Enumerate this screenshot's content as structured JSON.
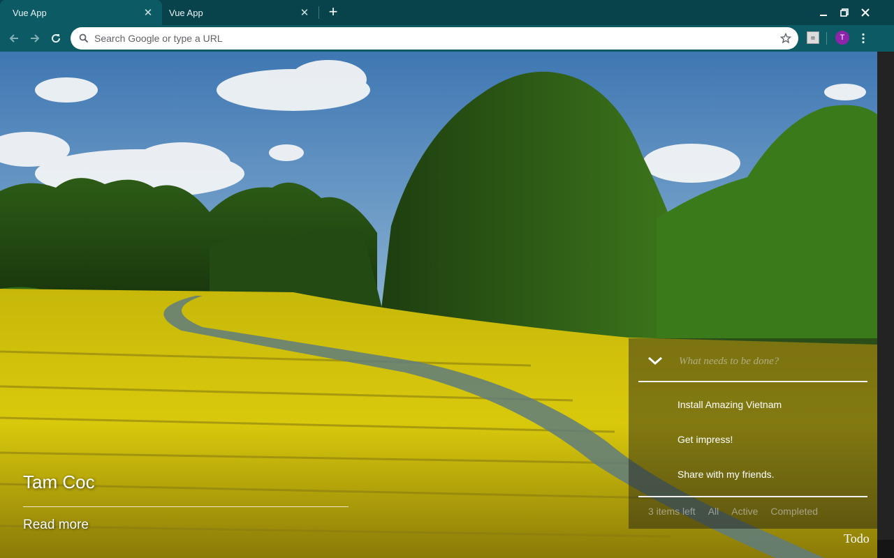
{
  "browser": {
    "tabs": [
      {
        "title": "Vue App",
        "active": true
      },
      {
        "title": "Vue App",
        "active": false
      }
    ],
    "new_tab_label": "+",
    "omnibox": {
      "placeholder": "Search Google or type a URL",
      "value": ""
    },
    "profile_initial": "T",
    "colors": {
      "tabstrip": "#08434b",
      "toolbar": "#0c5a64",
      "avatar": "#8e24aa"
    }
  },
  "slide": {
    "title": "Tam Coc",
    "read_more": "Read more"
  },
  "todo": {
    "placeholder": "What needs to be done?",
    "items": [
      {
        "text": "Install Amazing Vietnam",
        "completed": false
      },
      {
        "text": "Get impress!",
        "completed": false
      },
      {
        "text": "Share with my friends.",
        "completed": false
      }
    ],
    "footer": {
      "count": "3 items left",
      "filters": [
        "All",
        "Active",
        "Completed"
      ]
    },
    "label": "Todo"
  }
}
